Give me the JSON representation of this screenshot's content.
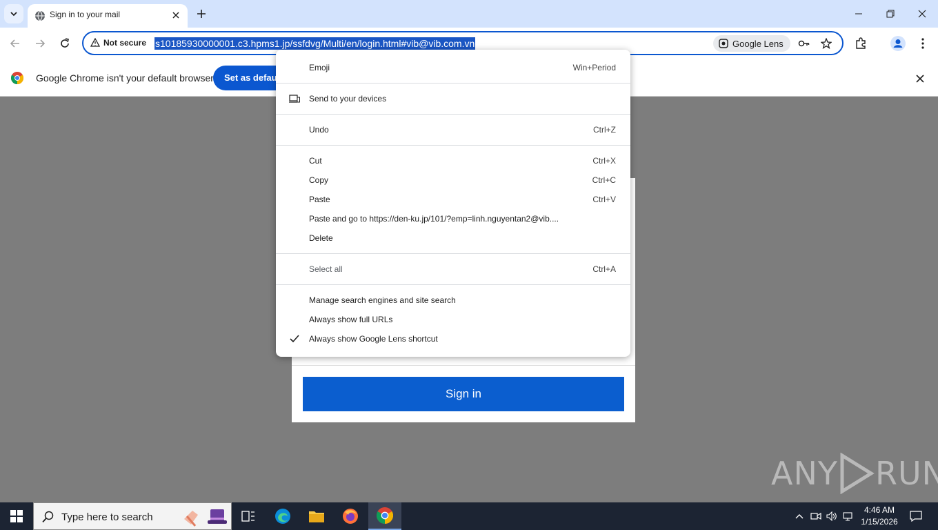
{
  "browser": {
    "tab": {
      "title": "Sign in to your mail"
    },
    "omnibox": {
      "security_label": "Not secure",
      "url": "s10185930000001.c3.hpms1.jp/ssfdvg/Multi/en/login.html#vib@vib.com.vn",
      "lens_label": "Google Lens"
    },
    "infobar": {
      "message": "Google Chrome isn't your default browser",
      "button_label": "Set as default"
    }
  },
  "page": {
    "signin_label": "Sign in",
    "watermark": "ANY RUN"
  },
  "context_menu": {
    "items": [
      {
        "label": "Emoji",
        "shortcut": "Win+Period"
      },
      {
        "label": "Send to your devices",
        "shortcut": ""
      },
      {
        "label": "Undo",
        "shortcut": "Ctrl+Z"
      },
      {
        "label": "Cut",
        "shortcut": "Ctrl+X"
      },
      {
        "label": "Copy",
        "shortcut": "Ctrl+C"
      },
      {
        "label": "Paste",
        "shortcut": "Ctrl+V"
      },
      {
        "label": "Paste and go to https://den-ku.jp/101/?emp=linh.nguyentan2@vib....",
        "shortcut": ""
      },
      {
        "label": "Delete",
        "shortcut": ""
      },
      {
        "label": "Select all",
        "shortcut": "Ctrl+A"
      },
      {
        "label": "Manage search engines and site search",
        "shortcut": ""
      },
      {
        "label": "Always show full URLs",
        "shortcut": ""
      },
      {
        "label": "Always show Google Lens shortcut",
        "shortcut": ""
      }
    ]
  },
  "taskbar": {
    "search_placeholder": "Type here to search",
    "time": "4:46 AM",
    "date": "1/15/2026"
  },
  "colors": {
    "accent": "#0b57d0",
    "tabstrip": "#d3e3fd",
    "taskbar": "#1c2433"
  }
}
